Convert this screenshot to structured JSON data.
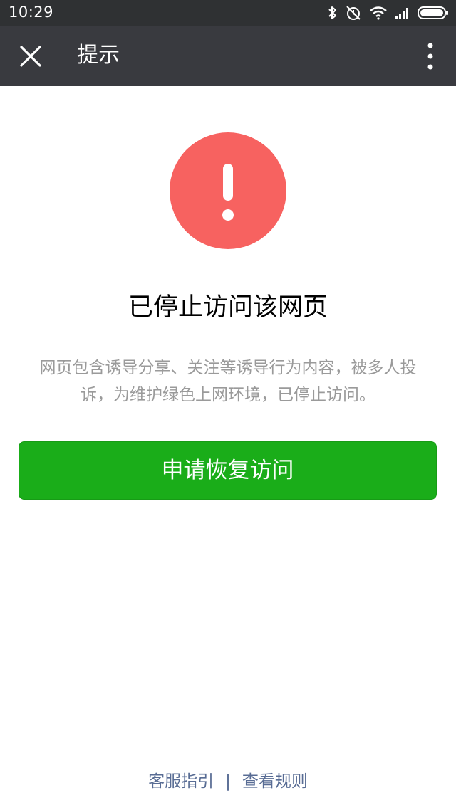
{
  "status_bar": {
    "time": "10:29",
    "icons": [
      "bluetooth-icon",
      "mute-alarm-icon",
      "wifi-icon",
      "signal-icon",
      "battery-icon"
    ]
  },
  "nav": {
    "title": "提示",
    "close_icon": "close-icon",
    "more_icon": "more-vertical-icon"
  },
  "message": {
    "icon": "warning-icon",
    "title": "已停止访问该网页",
    "description": "网页包含诱导分享、关注等诱导行为内容，被多人投诉，为维护绿色上网环境，已停止访问。"
  },
  "actions": {
    "primary_label": "申请恢复访问"
  },
  "footer": {
    "link1": "客服指引",
    "separator": "|",
    "link2": "查看规则"
  },
  "colors": {
    "status_bar_bg": "#2f3133",
    "nav_bg": "#393a3f",
    "warn_red": "#f76260",
    "primary_green": "#1aad19",
    "link_blue": "#586c94",
    "desc_gray": "#9a9a9a"
  }
}
